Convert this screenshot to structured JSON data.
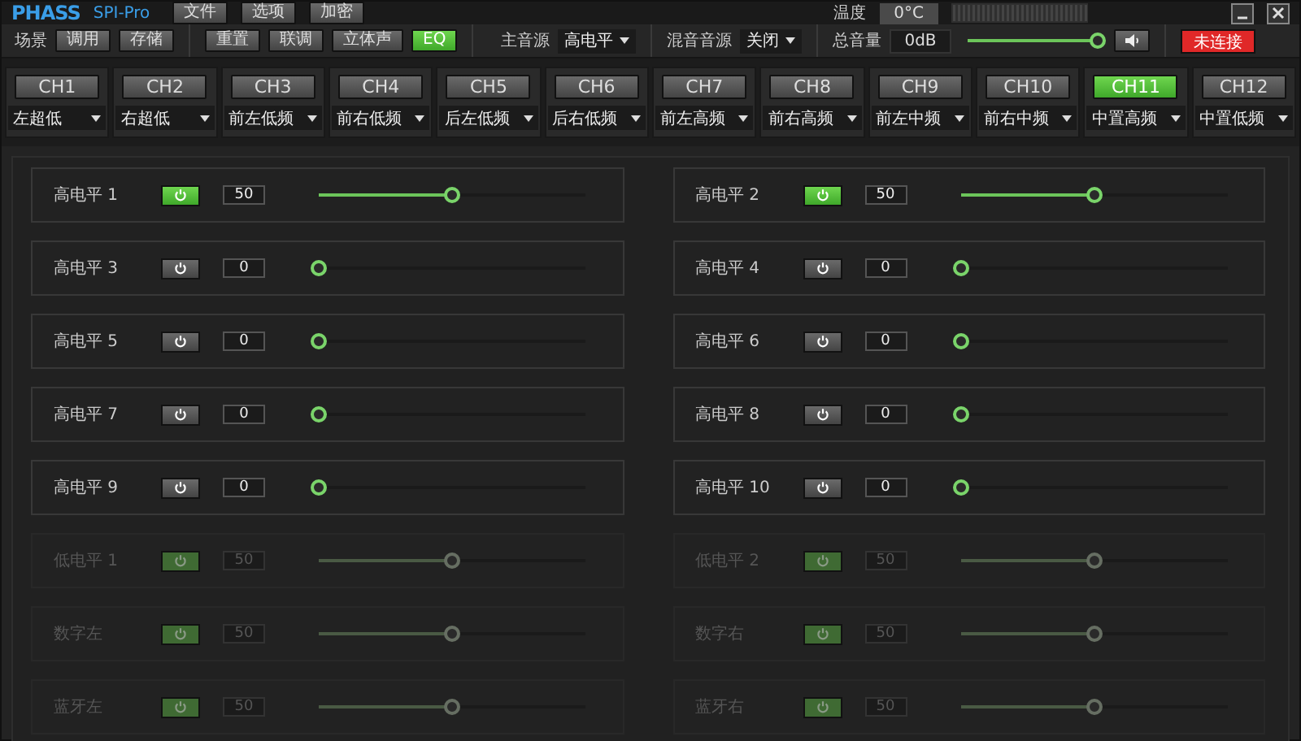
{
  "window": {
    "logo": "PHASS",
    "model": "SPI-Pro",
    "menu": [
      "文件",
      "选项",
      "加密"
    ],
    "temperature_label": "温度",
    "temperature": "0°C"
  },
  "toolbar": {
    "scene_label": "场景",
    "scene_buttons": [
      "调用",
      "存储"
    ],
    "mode_buttons": [
      {
        "label": "重置",
        "selected": false
      },
      {
        "label": "联调",
        "selected": false
      },
      {
        "label": "立体声",
        "selected": false
      },
      {
        "label": "EQ",
        "selected": true
      }
    ],
    "main_source_label": "主音源",
    "main_source": "高电平",
    "mix_source_label": "混音音源",
    "mix_source": "关闭",
    "volume_label": "总音量",
    "volume": {
      "reading": "0dB",
      "level": 1
    },
    "status": "未连接"
  },
  "channels": [
    {
      "name": "CH1",
      "selected": false,
      "output": "左超低"
    },
    {
      "name": "CH2",
      "selected": false,
      "output": "右超低"
    },
    {
      "name": "CH3",
      "selected": false,
      "output": "前左低频"
    },
    {
      "name": "CH4",
      "selected": false,
      "output": "前右低频"
    },
    {
      "name": "CH5",
      "selected": false,
      "output": "后左低频"
    },
    {
      "name": "CH6",
      "selected": false,
      "output": "后右低频"
    },
    {
      "name": "CH7",
      "selected": false,
      "output": "前左高频"
    },
    {
      "name": "CH8",
      "selected": false,
      "output": "前右高频"
    },
    {
      "name": "CH9",
      "selected": false,
      "output": "前左中频"
    },
    {
      "name": "CH10",
      "selected": false,
      "output": "前右中频"
    },
    {
      "name": "CH11",
      "selected": true,
      "output": "中置高频"
    },
    {
      "name": "CH12",
      "selected": false,
      "output": "中置低频"
    }
  ],
  "inputs": [
    {
      "label": "高电平 1",
      "on": true,
      "disabled": false,
      "value": "50",
      "level": 0.5
    },
    {
      "label": "高电平 2",
      "on": true,
      "disabled": false,
      "value": "50",
      "level": 0.5
    },
    {
      "label": "高电平 3",
      "on": false,
      "disabled": false,
      "value": "0",
      "level": 0
    },
    {
      "label": "高电平 4",
      "on": false,
      "disabled": false,
      "value": "0",
      "level": 0
    },
    {
      "label": "高电平 5",
      "on": false,
      "disabled": false,
      "value": "0",
      "level": 0
    },
    {
      "label": "高电平 6",
      "on": false,
      "disabled": false,
      "value": "0",
      "level": 0
    },
    {
      "label": "高电平 7",
      "on": false,
      "disabled": false,
      "value": "0",
      "level": 0
    },
    {
      "label": "高电平 8",
      "on": false,
      "disabled": false,
      "value": "0",
      "level": 0
    },
    {
      "label": "高电平 9",
      "on": false,
      "disabled": false,
      "value": "0",
      "level": 0
    },
    {
      "label": "高电平 10",
      "on": false,
      "disabled": false,
      "value": "0",
      "level": 0
    },
    {
      "label": "低电平 1",
      "on": true,
      "disabled": true,
      "value": "50",
      "level": 0.5
    },
    {
      "label": "低电平 2",
      "on": true,
      "disabled": true,
      "value": "50",
      "level": 0.5
    },
    {
      "label": "数字左",
      "on": true,
      "disabled": true,
      "value": "50",
      "level": 0.5
    },
    {
      "label": "数字右",
      "on": true,
      "disabled": true,
      "value": "50",
      "level": 0.5
    },
    {
      "label": "蓝牙左",
      "on": true,
      "disabled": true,
      "value": "50",
      "level": 0.5
    },
    {
      "label": "蓝牙右",
      "on": true,
      "disabled": true,
      "value": "50",
      "level": 0.5
    }
  ]
}
